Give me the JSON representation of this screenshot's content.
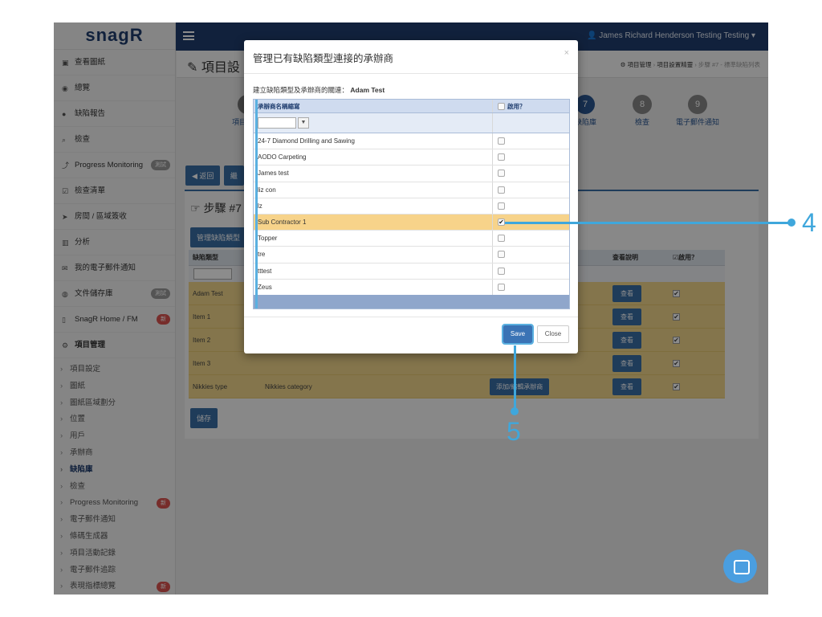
{
  "app": {
    "logo": "snagR",
    "user": "James Richard Henderson Testing Testing ▾"
  },
  "sidebar": {
    "items": [
      {
        "icon": "image-icon",
        "glyph": "▣",
        "label": "查看圖紙"
      },
      {
        "icon": "dashboard-icon",
        "glyph": "◉",
        "label": "總覽"
      },
      {
        "icon": "pin-icon",
        "glyph": "●",
        "label": "缺陷報告"
      },
      {
        "icon": "search-icon",
        "glyph": "⌕",
        "label": "檢查"
      },
      {
        "icon": "chart-icon",
        "glyph": "⤴",
        "label": "Progress Monitoring",
        "badge": "測試"
      },
      {
        "icon": "checklist-icon",
        "glyph": "☑",
        "label": "檢查清單"
      },
      {
        "icon": "send-icon",
        "glyph": "➤",
        "label": "房間 / 區域簽收"
      },
      {
        "icon": "bar-chart-icon",
        "glyph": "▥",
        "label": "分析"
      },
      {
        "icon": "mail-icon",
        "glyph": "✉",
        "label": "我的電子郵件通知"
      },
      {
        "icon": "folder-icon",
        "glyph": "◍",
        "label": "文件儲存庫",
        "badge": "測試"
      },
      {
        "icon": "tablet-icon",
        "glyph": "▯",
        "label": "SnagR Home / FM",
        "badge": "新"
      },
      {
        "icon": "cogs-icon",
        "glyph": "⚙",
        "label": "項目管理"
      }
    ],
    "subitems": [
      {
        "label": "項目設定"
      },
      {
        "label": "圖紙"
      },
      {
        "label": "圖紙區域劃分"
      },
      {
        "label": "位置"
      },
      {
        "label": "用戶"
      },
      {
        "label": "承辦商"
      },
      {
        "label": "缺陷庫",
        "active": true
      },
      {
        "label": "檢查"
      },
      {
        "label": "Progress Monitoring",
        "badge": "新"
      },
      {
        "label": "電子郵件通知"
      },
      {
        "label": "條碼生成器"
      },
      {
        "label": "項目活動記錄"
      },
      {
        "label": "電子郵件追踪"
      },
      {
        "label": "表現指標總覽",
        "badge": "新"
      }
    ]
  },
  "page": {
    "title": "項目設",
    "breadcrumb": {
      "a": "項目管理",
      "b": "項目設置精靈",
      "c": "步驟 #7 - 標準缺陷列表"
    },
    "steps": [
      {
        "num": "7",
        "label": "缺陷庫"
      },
      {
        "num": "8",
        "label": "檢查"
      },
      {
        "num": "9",
        "label": "電子郵件通知"
      }
    ],
    "step_label_partial": "項目",
    "back_button": "返回",
    "next_button_partial": "繼",
    "panel_title": "步驟 #7 -",
    "manage_button": "管理缺陷類型",
    "table": {
      "col_type": "缺陷類型",
      "col_desc": "查看說明",
      "col_enabled": "啟用？",
      "rows": [
        {
          "type": "Adam Test",
          "cat": "",
          "view": "查看"
        },
        {
          "type": "Item 1",
          "cat": "",
          "view": "查看"
        },
        {
          "type": "Item 2",
          "cat": "",
          "view": "查看"
        },
        {
          "type": "Item 3",
          "cat": "",
          "view": "查看"
        },
        {
          "type": "Nikkies type",
          "cat": "Nikkies category",
          "view": "查看",
          "edit": "添加/編輯承辦商"
        }
      ]
    },
    "save_button": "儲存"
  },
  "modal": {
    "title": "管理已有缺陷類型連接的承辦商",
    "close": "×",
    "subtitle_prefix": "建立缺陷類型及承辦商的關連：",
    "subtitle_name": "Adam Test",
    "col_name": "承辦商名稱縮寫",
    "col_enabled": "啟用？",
    "contractors": [
      {
        "name": "24-7 Diamond Drilling and Sawing",
        "checked": false
      },
      {
        "name": "AODO Carpeting",
        "checked": false
      },
      {
        "name": "James test",
        "checked": false
      },
      {
        "name": "liz con",
        "checked": false
      },
      {
        "name": "lz",
        "checked": false
      },
      {
        "name": "Sub Contractor 1",
        "checked": true
      },
      {
        "name": "Topper",
        "checked": false
      },
      {
        "name": "tre",
        "checked": false
      },
      {
        "name": "tttest",
        "checked": false
      },
      {
        "name": "Zeus",
        "checked": false
      }
    ],
    "save": "Save",
    "close_button": "Close"
  },
  "callouts": {
    "four": "4",
    "five": "5"
  },
  "colors": {
    "accent": "#3fa7dc",
    "nav": "#1f3d6e",
    "highlight": "#f7d38a"
  }
}
